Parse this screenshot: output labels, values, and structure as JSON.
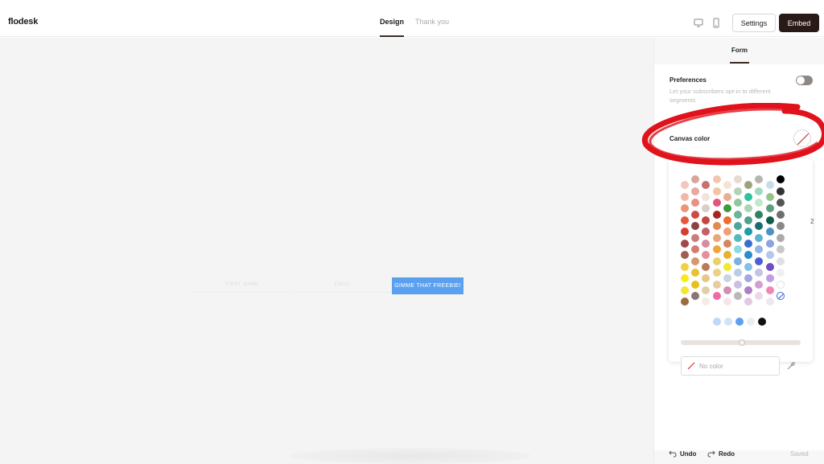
{
  "header": {
    "logo": "flodesk",
    "tabs": [
      {
        "label": "Design",
        "active": true
      },
      {
        "label": "Thank you",
        "active": false
      }
    ],
    "device_icons": [
      "desktop-icon",
      "mobile-icon"
    ],
    "settings_label": "Settings",
    "embed_label": "Embed"
  },
  "canvas": {
    "field_1": "FIRST NAME",
    "field_2": "EMAIL",
    "cta_label": "GIMME THAT FREEBIE!",
    "cta_color": "#5aa0ef"
  },
  "panel": {
    "tab_label": "Form",
    "preferences": {
      "title": "Preferences",
      "description": "Let your subscribers opt-in to different segments",
      "enabled": false
    },
    "canvas_color": {
      "label": "Canvas color",
      "value_label": "No color"
    },
    "palette": [
      [
        "#f0c9bb",
        "#f1b8a5",
        "#ee9377",
        "#e5573f",
        "#d33e30",
        "#9d4a49",
        "#a35c55",
        "#f2d043",
        "#f6eb1c",
        "#f6e532",
        "#9c6b3e"
      ],
      [
        "#d9a49a",
        "#e8a9a0",
        "#ea8f83",
        "#cf4747",
        "#8c4342",
        "#c87e81",
        "#d47b72",
        "#d6976d",
        "#e8c032",
        "#e7c11a",
        "#8a7773"
      ],
      [
        "#c9706e",
        "#f1e4dd",
        "#d7cfc8",
        "#c64543",
        "#c55f6a",
        "#d68da3",
        "#e88f9c",
        "#b77c5a",
        "#e8c784",
        "#ddd0a8",
        "#f2ede5"
      ],
      [
        "#f3c7ad",
        "#f1c5a2",
        "#e3547d",
        "#a52621",
        "#e08a4e",
        "#e6a879",
        "#f1a53b",
        "#e9d26b",
        "#ebd185",
        "#e8cc9e",
        "#f16aa7"
      ],
      [
        "#f4e3d7",
        "#e9ad90",
        "#3c9a3b",
        "#ed6e2e",
        "#f0a072",
        "#d5865f",
        "#e5b22a",
        "#f1e92c",
        "#c8d4e1",
        "#d38eb2",
        "#f4e6ea"
      ],
      [
        "#e2ddd0",
        "#b7d1b8",
        "#90c79f",
        "#6cb39b",
        "#4fa39d",
        "#56b8c0",
        "#86dbe6",
        "#7fb0e2",
        "#b7cde8",
        "#c9bfe0",
        "#b9b9b9"
      ],
      [
        "#9ea27b",
        "#2ec49a",
        "#aad4b3",
        "#4fa38a",
        "#1f9ba9",
        "#3a6fd0",
        "#2c8cd0",
        "#82c0e4",
        "#a4a7e2",
        "#ae7fc7",
        "#e4c7e3"
      ],
      [
        "#b5b6b0",
        "#a0d9c0",
        "#bfe9c9",
        "#2e8262",
        "#1b6c6f",
        "#5fb2cf",
        "#97b2e4",
        "#4c5fd0",
        "#c7c1e4",
        "#d39ed2",
        "#e8d9ec"
      ],
      [
        "#c9dde8",
        "#95c48b",
        "#5b9f81",
        "#0f5c4c",
        "#4f91c4",
        "#89a5dc",
        "#b8c5ec",
        "#6e4fc4",
        "#c09de1",
        "#f086b6",
        "#eee7ef"
      ],
      [
        "#000000",
        "#333333",
        "#555555",
        "#6e6e6e",
        "#888888",
        "#aaaaaa",
        "#c8c8c8",
        "#e0e0e0",
        "#f0f0f0",
        "#ffffff",
        "none"
      ]
    ],
    "recent_colors": [
      "#bfd8f6",
      "#d3e2f5",
      "#5d9ff0",
      "#e8eef3",
      "#111111"
    ],
    "side_number": "2"
  },
  "footer": {
    "undo_label": "Undo",
    "redo_label": "Redo",
    "status": "Saved"
  },
  "accent": {
    "dark": "#2a1a17",
    "annotation": "#e0121b"
  }
}
